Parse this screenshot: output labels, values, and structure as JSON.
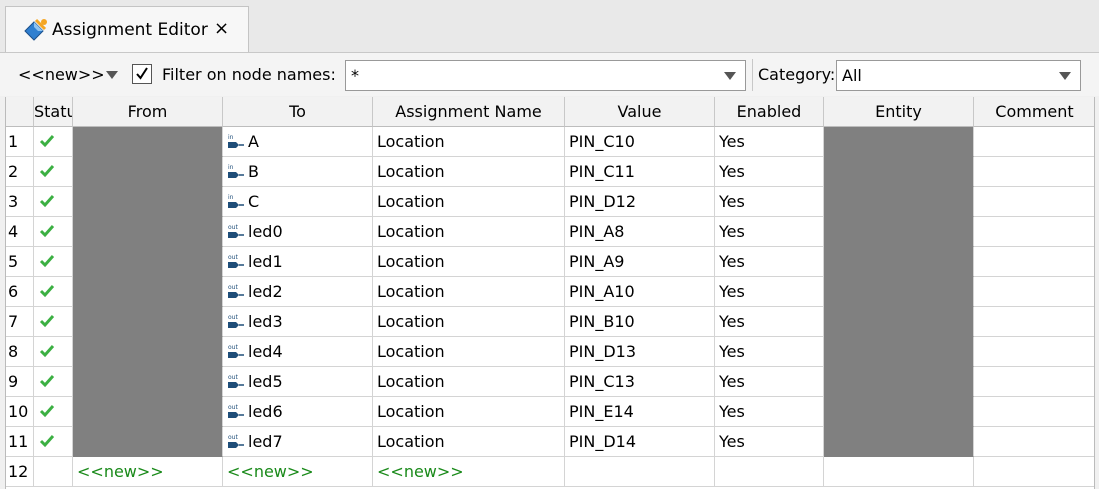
{
  "tab": {
    "title": "Assignment Editor",
    "close_icon": "×"
  },
  "toolbar": {
    "new_label": "<<new>>",
    "filter_checked": true,
    "filter_label": "Filter on node names:",
    "filter_value": "*",
    "category_label": "Category:",
    "category_value": "All"
  },
  "columns": [
    "Statu",
    "From",
    "To",
    "Assignment Name",
    "Value",
    "Enabled",
    "Entity",
    "Comment"
  ],
  "rows": [
    {
      "num": "1",
      "dir": "in",
      "to": "A",
      "name": "Location",
      "value": "PIN_C10",
      "enabled": "Yes"
    },
    {
      "num": "2",
      "dir": "in",
      "to": "B",
      "name": "Location",
      "value": "PIN_C11",
      "enabled": "Yes"
    },
    {
      "num": "3",
      "dir": "in",
      "to": "C",
      "name": "Location",
      "value": "PIN_D12",
      "enabled": "Yes"
    },
    {
      "num": "4",
      "dir": "out",
      "to": "led0",
      "name": "Location",
      "value": "PIN_A8",
      "enabled": "Yes"
    },
    {
      "num": "5",
      "dir": "out",
      "to": "led1",
      "name": "Location",
      "value": "PIN_A9",
      "enabled": "Yes"
    },
    {
      "num": "6",
      "dir": "out",
      "to": "led2",
      "name": "Location",
      "value": "PIN_A10",
      "enabled": "Yes"
    },
    {
      "num": "7",
      "dir": "out",
      "to": "led3",
      "name": "Location",
      "value": "PIN_B10",
      "enabled": "Yes"
    },
    {
      "num": "8",
      "dir": "out",
      "to": "led4",
      "name": "Location",
      "value": "PIN_D13",
      "enabled": "Yes"
    },
    {
      "num": "9",
      "dir": "out",
      "to": "led5",
      "name": "Location",
      "value": "PIN_C13",
      "enabled": "Yes"
    },
    {
      "num": "10",
      "dir": "out",
      "to": "led6",
      "name": "Location",
      "value": "PIN_E14",
      "enabled": "Yes"
    },
    {
      "num": "11",
      "dir": "out",
      "to": "led7",
      "name": "Location",
      "value": "PIN_D14",
      "enabled": "Yes"
    }
  ],
  "new_row": {
    "num": "12",
    "from": "<<new>>",
    "to": "<<new>>",
    "name": "<<new>>"
  },
  "colors": {
    "check": "#3cb043",
    "new_text": "#1a8a1a",
    "gray_cell": "#808080",
    "pin_icon": "#1f4e79"
  }
}
